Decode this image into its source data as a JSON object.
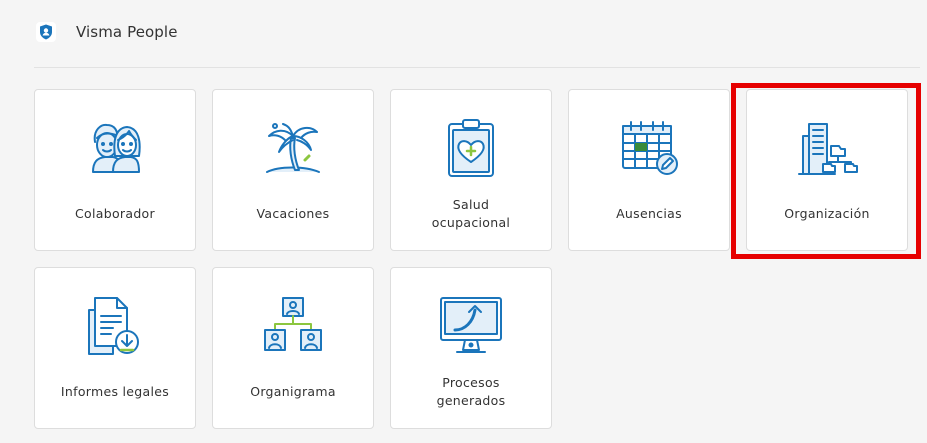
{
  "app": {
    "title": "Visma People",
    "logo_icon": "user-shield-icon"
  },
  "colors": {
    "accent": "#1b75bb",
    "icon_light": "#e3eff9",
    "green": "#8cc63f",
    "highlight": "#e60000"
  },
  "tiles": [
    {
      "label": "Colaborador",
      "icon": "people-icon"
    },
    {
      "label": "Vacaciones",
      "icon": "palm-tree-icon"
    },
    {
      "label": "Salud\nocupacional",
      "icon": "health-clipboard-icon"
    },
    {
      "label": "Ausencias",
      "icon": "calendar-edit-icon"
    },
    {
      "label": "Organización",
      "icon": "organization-building-icon"
    },
    {
      "label": "Informes legales",
      "icon": "legal-report-download-icon"
    },
    {
      "label": "Organigrama",
      "icon": "org-chart-icon"
    },
    {
      "label": "Procesos\ngenerados",
      "icon": "monitor-trend-icon"
    }
  ]
}
